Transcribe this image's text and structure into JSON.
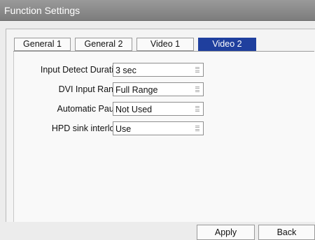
{
  "window": {
    "title": "Function Settings"
  },
  "tabs": [
    {
      "label": "General 1",
      "active": false
    },
    {
      "label": "General 2",
      "active": false
    },
    {
      "label": "Video 1",
      "active": false
    },
    {
      "label": "Video 2",
      "active": true
    }
  ],
  "settings": [
    {
      "label": "Input Detect Duration",
      "value": "3 sec"
    },
    {
      "label": "DVI Input Range",
      "value": "Full Range"
    },
    {
      "label": "Automatic Pause",
      "value": "Not Used"
    },
    {
      "label": "HPD sink interlock",
      "value": "Use"
    }
  ],
  "buttons": {
    "apply": "Apply",
    "back": "Back"
  },
  "colors": {
    "active_tab": "#1f3f9e",
    "titlebar": "#8c8c8c"
  }
}
